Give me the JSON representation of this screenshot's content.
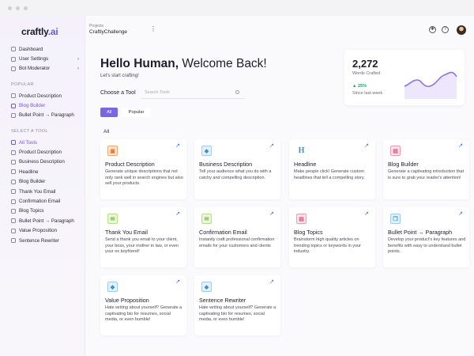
{
  "sidebar": {
    "logo_main": "craftly",
    "logo_accent": ".ai",
    "top_items": [
      {
        "label": "Dashboard"
      },
      {
        "label": "User Settings"
      },
      {
        "label": "Bot Moderator"
      }
    ],
    "popular_label": "POPULAR",
    "popular_items": [
      {
        "label": "Product Description"
      },
      {
        "label": "Blog Builder"
      },
      {
        "label": "Bullet Point → Paragraph"
      }
    ],
    "tools_label": "SELECT A TOOL",
    "tool_items": [
      {
        "label": "All Tools"
      },
      {
        "label": "Product Description"
      },
      {
        "label": "Business Description"
      },
      {
        "label": "Headline"
      },
      {
        "label": "Blog Builder"
      },
      {
        "label": "Thank You Email"
      },
      {
        "label": "Confirmation Email"
      },
      {
        "label": "Blog Topics"
      },
      {
        "label": "Bullet Point → Paragraph"
      },
      {
        "label": "Value Proposition"
      },
      {
        "label": "Sentence Rewriter"
      }
    ]
  },
  "topbar": {
    "projects_label": "Projects",
    "project_name": "CraftlyChallenge",
    "more": "⋮"
  },
  "hero": {
    "greeting_bold": "Hello Human,",
    "greeting_rest": " Welcome Back!",
    "subtitle": "Let's start crafting!"
  },
  "tools_bar": {
    "choose_label": "Choose a Tool",
    "search_placeholder": "Search Tools",
    "filters": [
      "All",
      "Popular"
    ],
    "section_title": "All"
  },
  "stats": {
    "value": "2,272",
    "label": "Words Crafted",
    "change": "▲ 25%",
    "since": "Since last week"
  },
  "cards": [
    {
      "title": "Product Description",
      "desc": "Generate unique descriptions that not only rank well in search engines but also sell your products.",
      "icon": "image-icon"
    },
    {
      "title": "Business Description",
      "desc": "Tell your audience what you do with a catchy and compelling description.",
      "icon": "diamond-icon"
    },
    {
      "title": "Headline",
      "desc": "Make people click! Generate custom headlines that tell a compelling story.",
      "icon": "heading-icon",
      "glyph": "H"
    },
    {
      "title": "Blog Builder",
      "desc": "Generate a captivating introduction that is sure to grab your reader's attention!",
      "icon": "blog-icon"
    },
    {
      "title": "Thank You Email",
      "desc": "Send a thank you email to your client, your boss, your mother in law, or even your ex boyfriend!",
      "icon": "mail-icon"
    },
    {
      "title": "Confirmation Email",
      "desc": "Instantly craft professional confirmation emails for your customers and clients",
      "icon": "mail-check-icon"
    },
    {
      "title": "Blog Topics",
      "desc": "Brainstorm high quality articles on trending topics or keywords in your industry.",
      "icon": "blog-topics-icon"
    },
    {
      "title": "Bullet Point → Paragraph",
      "desc": "Develop your product's key features and benefits with easy to understand bullet points.",
      "icon": "chat-icon"
    },
    {
      "title": "Value Proposition",
      "desc": "Hate writing about yourself? Generate a captivating bio for resumes, social media, or even bumble!",
      "icon": "diamond-icon"
    },
    {
      "title": "Sentence Rewriter",
      "desc": "Hate writing about yourself? Generate a captivating bio for resumes, social media, or even bumble!",
      "icon": "diamond-icon"
    }
  ],
  "colors": {
    "accent": "#7a66e0",
    "positive": "#1fa36b",
    "link_arrow": "#2f6bff"
  }
}
